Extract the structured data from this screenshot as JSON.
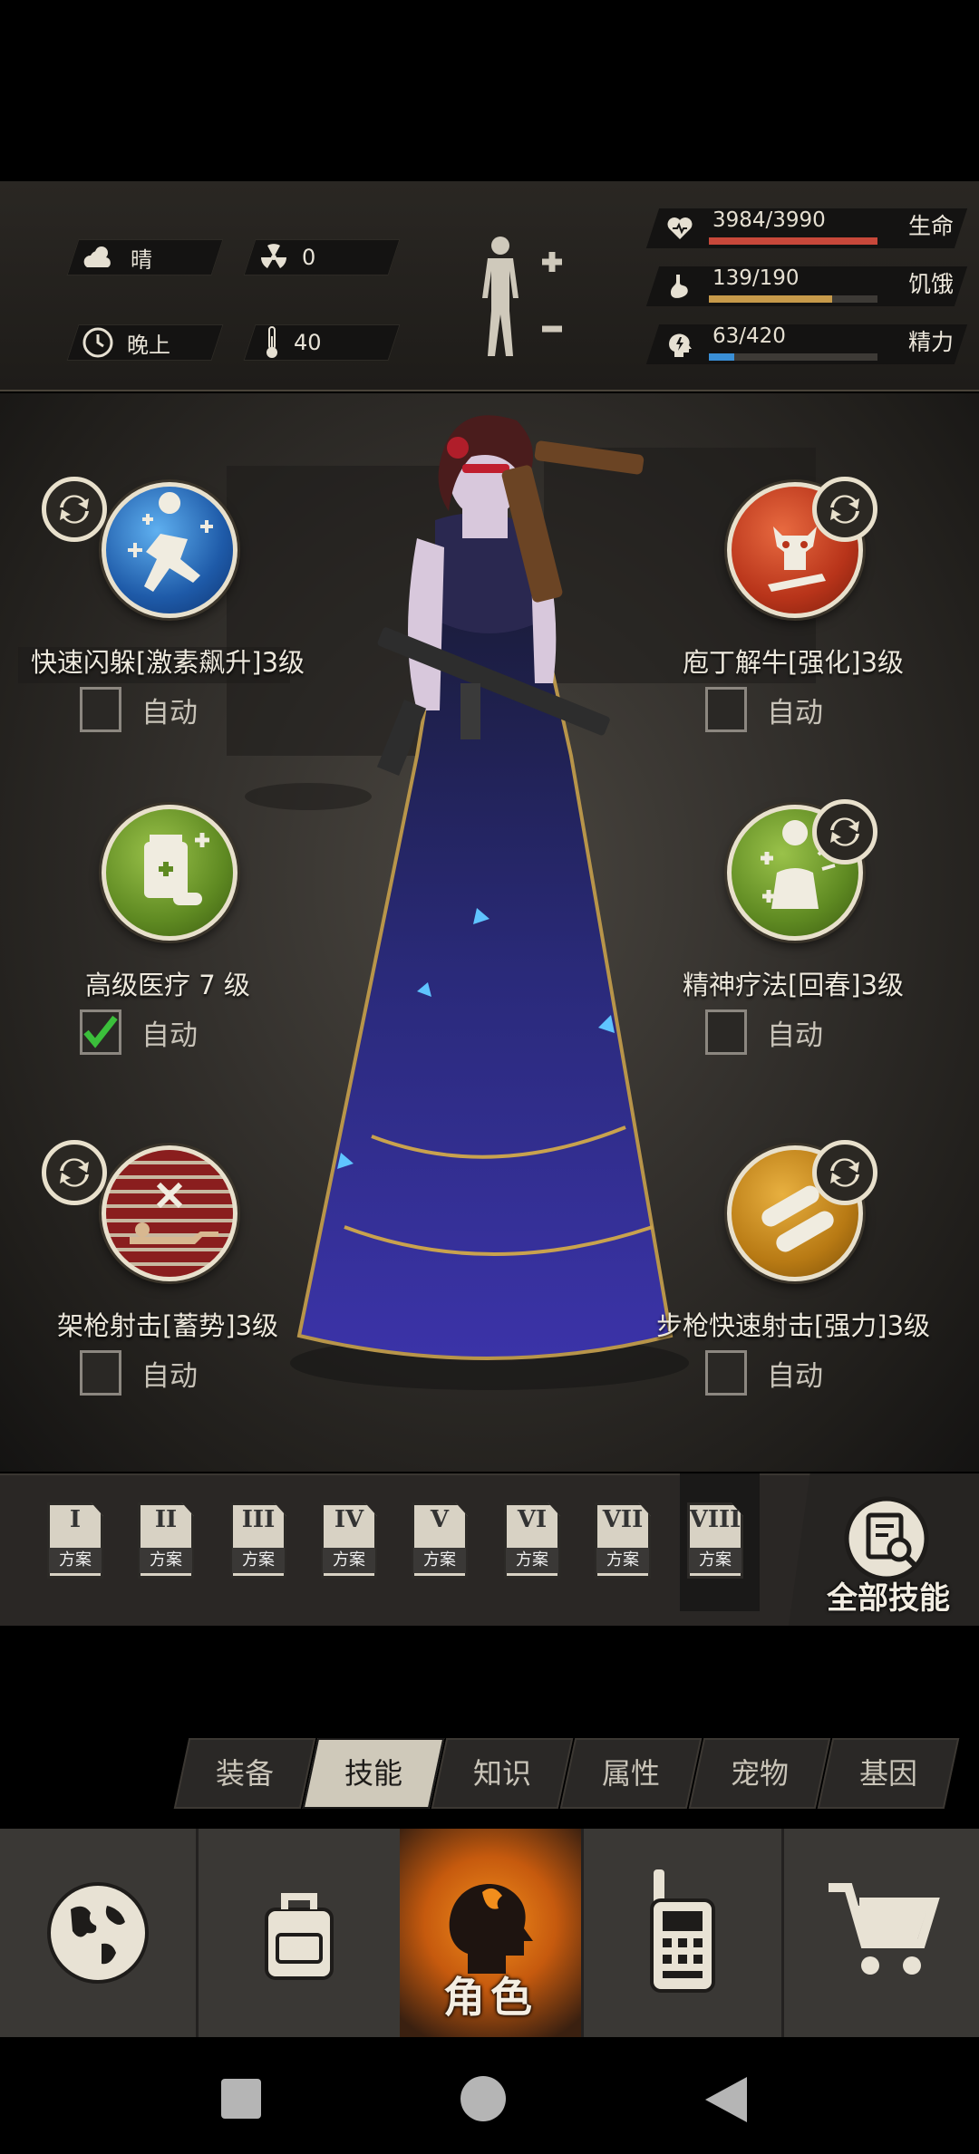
{
  "status": {
    "weather": {
      "icon": "cloud-sun-icon",
      "value": "晴"
    },
    "radiation": {
      "icon": "radiation-icon",
      "value": "0"
    },
    "time": {
      "icon": "clock-icon",
      "value": "晚上"
    },
    "temperature": {
      "icon": "thermometer-icon",
      "value": "40"
    },
    "stats": [
      {
        "icon": "heart-icon",
        "value": "3984/3990",
        "label": "生命",
        "fill": 0.998,
        "color": "#c8483a"
      },
      {
        "icon": "stomach-icon",
        "value": "139/190",
        "label": "饥饿",
        "fill": 0.73,
        "color": "#c79a4a"
      },
      {
        "icon": "energy-head-icon",
        "value": "63/420",
        "label": "精力",
        "fill": 0.15,
        "color": "#3a8fd6"
      }
    ]
  },
  "skills": [
    {
      "name": "快速闪躲[激素飙升]3级",
      "auto_label": "自动",
      "auto": false,
      "icon": "dodge-skill-icon"
    },
    {
      "name": "庖丁解牛[强化]3级",
      "auto_label": "自动",
      "auto": false,
      "icon": "butcher-skill-icon"
    },
    {
      "name": "高级医疗 7 级",
      "auto_label": "自动",
      "auto": true,
      "icon": "medical-skill-icon"
    },
    {
      "name": "精神疗法[回春]3级",
      "auto_label": "自动",
      "auto": false,
      "icon": "psychotherapy-skill-icon"
    },
    {
      "name": "架枪射击[蓄势]3级",
      "auto_label": "自动",
      "auto": false,
      "icon": "mounted-shot-skill-icon"
    },
    {
      "name": "步枪快速射击[强力]3级",
      "auto_label": "自动",
      "auto": false,
      "icon": "rifle-rapid-fire-skill-icon"
    }
  ],
  "plans": {
    "numerals": [
      "I",
      "II",
      "III",
      "IV",
      "V",
      "VI",
      "VII",
      "VIII"
    ],
    "label": "方案",
    "selected": "VIII"
  },
  "all_skills_label": "全部技能",
  "tabs": [
    "装备",
    "技能",
    "知识",
    "属性",
    "宠物",
    "基因"
  ],
  "active_tab": "技能",
  "nav": {
    "items": [
      "globe-icon",
      "backpack-icon",
      "character-icon",
      "walkie-talkie-icon",
      "cart-icon"
    ],
    "active_label": "角色"
  }
}
